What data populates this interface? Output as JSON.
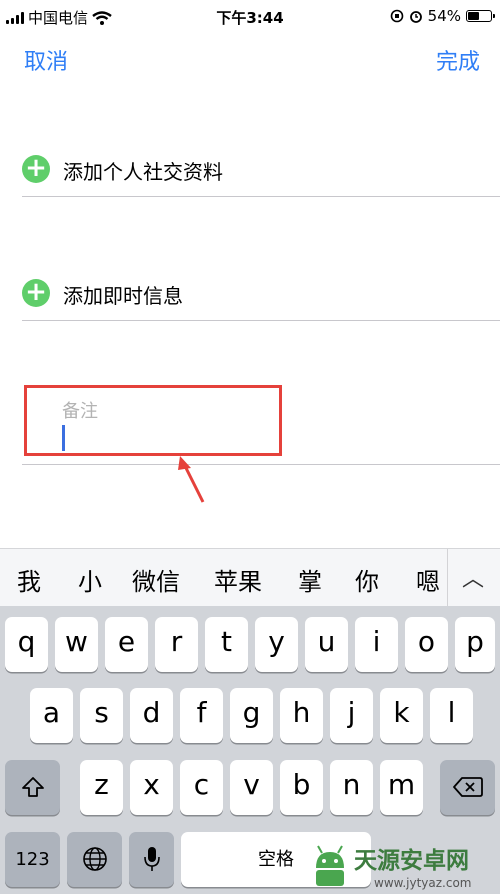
{
  "status_bar": {
    "carrier": "中国电信",
    "time": "下午3:44",
    "battery_pct": "54%",
    "battery_level": 0.54
  },
  "nav": {
    "cancel_label": "取消",
    "done_label": "完成"
  },
  "rows": [
    {
      "label": "添加个人社交资料"
    },
    {
      "label": "添加即时信息"
    }
  ],
  "notes": {
    "placeholder": "备注"
  },
  "candidates": [
    "我",
    "小",
    "微信",
    "苹果",
    "掌",
    "你",
    "嗯"
  ],
  "candidates_expand": "︿",
  "keyboard": {
    "row1": [
      "q",
      "w",
      "e",
      "r",
      "t",
      "y",
      "u",
      "i",
      "o",
      "p"
    ],
    "row2": [
      "a",
      "s",
      "d",
      "f",
      "g",
      "h",
      "j",
      "k",
      "l"
    ],
    "row3": [
      "z",
      "x",
      "c",
      "v",
      "b",
      "n",
      "m"
    ],
    "numbers_label": "123",
    "space_label": "空格"
  },
  "colors": {
    "accent": "#2f7ef6",
    "add_green": "#5fce6a",
    "highlight_red": "#e5413b"
  },
  "watermark": {
    "name": "天源安卓网",
    "url": "www.jytyaz.com"
  }
}
